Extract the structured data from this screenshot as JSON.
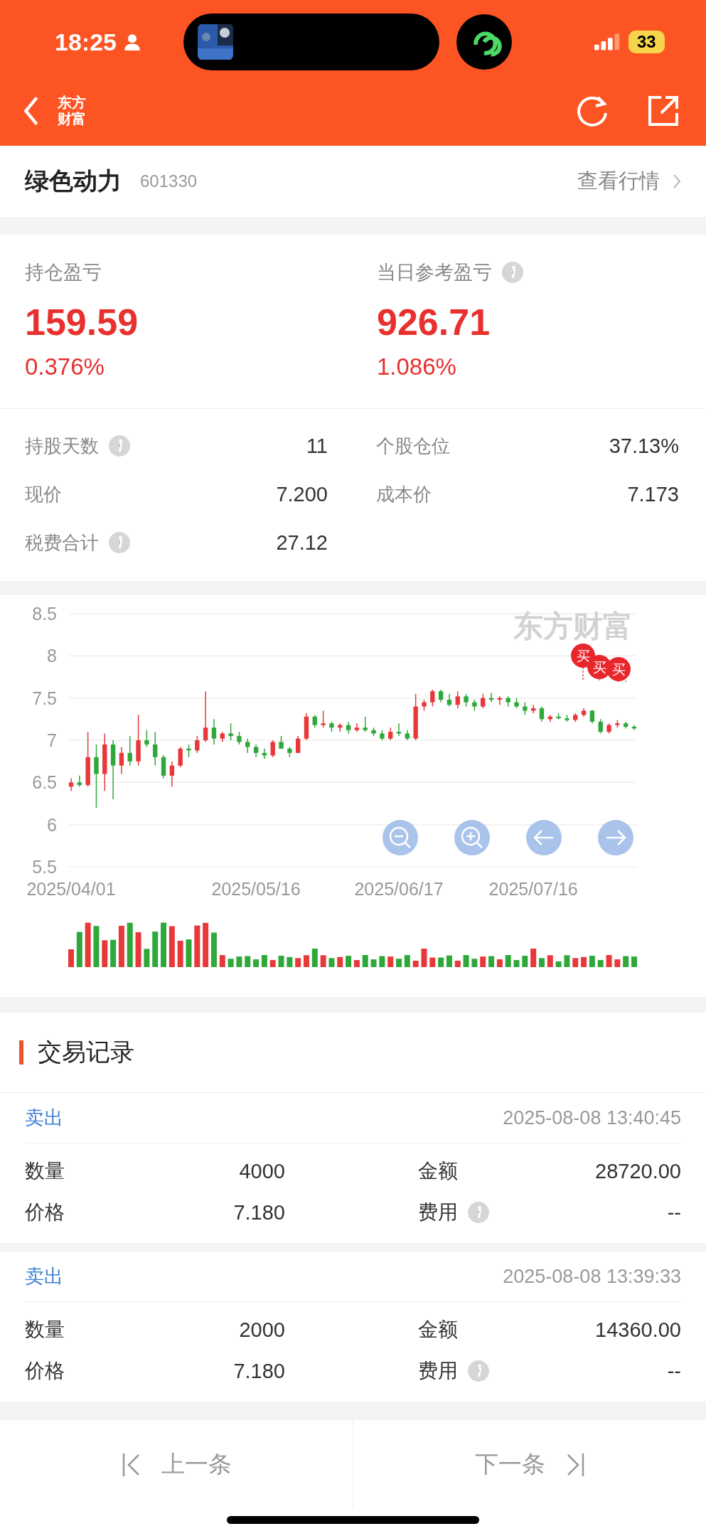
{
  "status_bar": {
    "time": "18:25",
    "battery": "33"
  },
  "nav": {
    "logo": "东方财富"
  },
  "stock": {
    "name": "绿色动力",
    "code": "601330",
    "link": "查看行情"
  },
  "pnl": [
    {
      "label": "持仓盈亏",
      "info": false,
      "value": "159.59",
      "percent": "0.376%"
    },
    {
      "label": "当日参考盈亏",
      "info": true,
      "value": "926.71",
      "percent": "1.086%"
    }
  ],
  "details": [
    {
      "label": "持股天数",
      "info": true,
      "value": "11"
    },
    {
      "label": "个股仓位",
      "info": false,
      "value": "37.13%"
    },
    {
      "label": "现价",
      "info": false,
      "value": "7.200"
    },
    {
      "label": "成本价",
      "info": false,
      "value": "7.173"
    },
    {
      "label": "税费合计",
      "info": true,
      "value": "27.12"
    }
  ],
  "chart": {
    "watermark": "东方财富",
    "buy_markers": [
      "买",
      "买",
      "买"
    ],
    "chart_data": {
      "type": "candlestick",
      "grid": true,
      "ylim": [
        5.5,
        8.5
      ],
      "yticks": [
        8.5,
        8,
        7.5,
        7,
        6.5,
        6,
        5.5
      ],
      "categories": [
        "2025/04/01",
        null,
        null,
        null,
        null,
        null,
        null,
        null,
        null,
        null,
        null,
        null,
        null,
        null,
        null,
        null,
        null,
        null,
        null,
        null,
        null,
        null,
        "2025/05/16",
        null,
        null,
        null,
        null,
        null,
        null,
        null,
        null,
        null,
        null,
        null,
        null,
        null,
        null,
        null,
        null,
        "2025/06/17",
        null,
        null,
        null,
        null,
        null,
        null,
        null,
        null,
        null,
        null,
        null,
        null,
        null,
        null,
        null,
        "2025/07/16",
        null,
        null,
        null,
        null,
        null,
        null,
        null,
        null,
        null,
        null,
        null,
        null
      ],
      "ohlc": [
        [
          6.45,
          6.55,
          6.4,
          6.5
        ],
        [
          6.5,
          6.58,
          6.45,
          6.47
        ],
        [
          6.47,
          7.1,
          6.45,
          6.8
        ],
        [
          6.8,
          6.95,
          6.2,
          6.6
        ],
        [
          6.6,
          7.08,
          6.4,
          6.95
        ],
        [
          6.95,
          7.0,
          6.3,
          6.7
        ],
        [
          6.7,
          6.92,
          6.6,
          6.85
        ],
        [
          6.85,
          7.05,
          6.7,
          6.75
        ],
        [
          6.75,
          7.3,
          6.7,
          7.0
        ],
        [
          7.0,
          7.12,
          6.92,
          6.95
        ],
        [
          6.95,
          7.1,
          6.7,
          6.8
        ],
        [
          6.8,
          6.82,
          6.55,
          6.58
        ],
        [
          6.58,
          6.75,
          6.45,
          6.7
        ],
        [
          6.7,
          6.92,
          6.68,
          6.9
        ],
        [
          6.9,
          6.95,
          6.8,
          6.88
        ],
        [
          6.88,
          7.05,
          6.85,
          7.0
        ],
        [
          7.0,
          7.58,
          6.98,
          7.15
        ],
        [
          7.15,
          7.25,
          6.95,
          7.02
        ],
        [
          7.02,
          7.1,
          6.98,
          7.08
        ],
        [
          7.08,
          7.2,
          7.0,
          7.05
        ],
        [
          7.05,
          7.1,
          6.95,
          6.98
        ],
        [
          6.98,
          7.02,
          6.85,
          6.92
        ],
        [
          6.92,
          6.95,
          6.8,
          6.85
        ],
        [
          6.85,
          6.9,
          6.78,
          6.82
        ],
        [
          6.82,
          7.0,
          6.8,
          6.98
        ],
        [
          6.98,
          7.05,
          6.9,
          6.9
        ],
        [
          6.9,
          6.92,
          6.8,
          6.85
        ],
        [
          6.85,
          7.05,
          6.85,
          7.02
        ],
        [
          7.02,
          7.32,
          7.0,
          7.28
        ],
        [
          7.28,
          7.3,
          7.15,
          7.18
        ],
        [
          7.18,
          7.35,
          7.15,
          7.2
        ],
        [
          7.2,
          7.22,
          7.1,
          7.15
        ],
        [
          7.15,
          7.2,
          7.1,
          7.18
        ],
        [
          7.18,
          7.22,
          7.08,
          7.12
        ],
        [
          7.12,
          7.2,
          7.1,
          7.15
        ],
        [
          7.15,
          7.28,
          7.1,
          7.12
        ],
        [
          7.12,
          7.15,
          7.05,
          7.08
        ],
        [
          7.08,
          7.12,
          7.0,
          7.02
        ],
        [
          7.02,
          7.15,
          7.0,
          7.1
        ],
        [
          7.1,
          7.2,
          7.05,
          7.08
        ],
        [
          7.08,
          7.12,
          7.0,
          7.02
        ],
        [
          7.02,
          7.55,
          7.0,
          7.4
        ],
        [
          7.4,
          7.48,
          7.35,
          7.45
        ],
        [
          7.45,
          7.6,
          7.4,
          7.58
        ],
        [
          7.58,
          7.6,
          7.45,
          7.48
        ],
        [
          7.48,
          7.55,
          7.4,
          7.42
        ],
        [
          7.42,
          7.58,
          7.38,
          7.52
        ],
        [
          7.52,
          7.55,
          7.4,
          7.45
        ],
        [
          7.45,
          7.48,
          7.35,
          7.4
        ],
        [
          7.4,
          7.55,
          7.38,
          7.5
        ],
        [
          7.5,
          7.56,
          7.45,
          7.48
        ],
        [
          7.48,
          7.52,
          7.42,
          7.5
        ],
        [
          7.5,
          7.52,
          7.4,
          7.45
        ],
        [
          7.45,
          7.5,
          7.38,
          7.4
        ],
        [
          7.4,
          7.45,
          7.3,
          7.35
        ],
        [
          7.35,
          7.42,
          7.32,
          7.38
        ],
        [
          7.38,
          7.4,
          7.22,
          7.25
        ],
        [
          7.25,
          7.3,
          7.22,
          7.28
        ],
        [
          7.28,
          7.32,
          7.25,
          7.26
        ],
        [
          7.26,
          7.3,
          7.22,
          7.24
        ],
        [
          7.24,
          7.32,
          7.22,
          7.3
        ],
        [
          7.3,
          7.38,
          7.28,
          7.35
        ],
        [
          7.35,
          7.36,
          7.2,
          7.22
        ],
        [
          7.22,
          7.25,
          7.08,
          7.1
        ],
        [
          7.1,
          7.2,
          7.08,
          7.18
        ],
        [
          7.18,
          7.24,
          7.15,
          7.2
        ],
        [
          7.2,
          7.22,
          7.14,
          7.16
        ],
        [
          7.16,
          7.18,
          7.12,
          7.14
        ]
      ]
    }
  },
  "records_title": "交易记录",
  "records": [
    {
      "side": "卖出",
      "time": "2025-08-08 13:40:45",
      "fields": [
        {
          "label": "数量",
          "info": false,
          "value": "4000"
        },
        {
          "label": "金额",
          "info": false,
          "value": "28720.00"
        },
        {
          "label": "价格",
          "info": false,
          "value": "7.180"
        },
        {
          "label": "费用",
          "info": true,
          "value": "--"
        }
      ]
    },
    {
      "side": "卖出",
      "time": "2025-08-08 13:39:33",
      "fields": [
        {
          "label": "数量",
          "info": false,
          "value": "2000"
        },
        {
          "label": "金额",
          "info": false,
          "value": "14360.00"
        },
        {
          "label": "价格",
          "info": false,
          "value": "7.180"
        },
        {
          "label": "费用",
          "info": true,
          "value": "--"
        }
      ]
    }
  ],
  "pager": {
    "prev": "上一条",
    "next": "下一条"
  }
}
